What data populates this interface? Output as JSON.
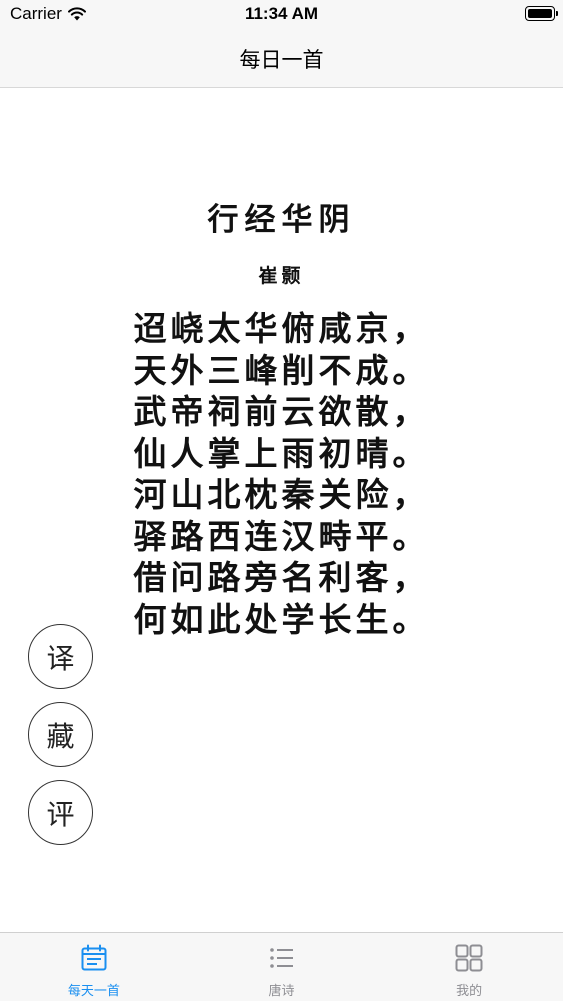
{
  "status_bar": {
    "carrier": "Carrier",
    "time": "11:34 AM"
  },
  "nav": {
    "title": "每日一首"
  },
  "poem": {
    "title": "行经华阴",
    "author": "崔颢",
    "lines": [
      "迢峣太华俯咸京，",
      "天外三峰削不成。",
      "武帝祠前云欲散，",
      "仙人掌上雨初晴。",
      "河山北枕秦关险，",
      "驿路西连汉畤平。",
      "借问路旁名利客，",
      "何如此处学长生。"
    ]
  },
  "actions": {
    "translate": "译",
    "collect": "藏",
    "comment": "评"
  },
  "tabs": [
    {
      "label": "每天一首",
      "icon": "calendar-icon",
      "active": true
    },
    {
      "label": "唐诗",
      "icon": "list-icon",
      "active": false
    },
    {
      "label": "我的",
      "icon": "grid-icon",
      "active": false
    }
  ],
  "colors": {
    "accent": "#1a8ff0",
    "inactive": "#8e8e93",
    "bar_bg": "#f7f7f7"
  }
}
